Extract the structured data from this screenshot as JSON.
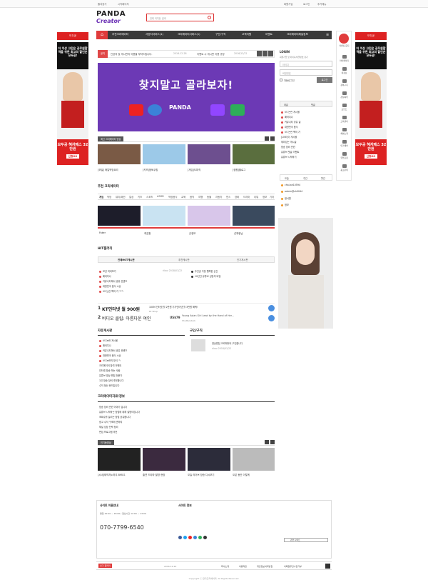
{
  "topbar": {
    "left1": "즐겨찾기",
    "left2": "시작페이지",
    "r1": "회원가입",
    "r2": "로그인",
    "r3": "추가메뉴"
  },
  "logo": {
    "line1": "PANDA",
    "line2": "Creator"
  },
  "search": {
    "placeholder": "언제 어디든 검색"
  },
  "nav": {
    "items": [
      "추천크리에이터",
      "사업자서비스(1)",
      "크리에이터서비스(1)",
      "구인/구직",
      "고객지원",
      "이벤트",
      "크리에이터채널정보"
    ]
  },
  "ad": {
    "head": "모두공",
    "black": "더 이상 고민은 공무원합격을 위한 최고의 할인은 모두공!",
    "foot": "모두공 혜자패스 32만원",
    "cta": "신청GO"
  },
  "notice": {
    "label": "공지",
    "text": "인공의 및 게시판의 이용을 부탁드립니다.",
    "date": "2016-12-28",
    "text2": "이벤트 시 게시판 이용 규정",
    "date2": "2016/12/22"
  },
  "banner": {
    "title": "찾지말고 골라보자!",
    "logo": "PANDA"
  },
  "sidebar": {
    "items": [
      "이벤트/공지",
      "마이페이지",
      "내정보",
      "장바구니",
      "관심목록",
      "포인트",
      "고객센터",
      "채널소개",
      "인기채널",
      "협업요청",
      "광고문의"
    ]
  },
  "recent": {
    "label": "최신 크리에이터 영상",
    "caps": [
      "[모빌] 매일먹방요리",
      "[키즈]점토쿠킹",
      "[게임]도파직",
      "[캠핑]블로그"
    ]
  },
  "rec": {
    "title": "추천 크리에이터",
    "tabs": [
      "게임",
      "먹방",
      "뷰티/패션",
      "일상",
      "키즈",
      "스포츠",
      "ASMR",
      "먹방음식",
      "교육",
      "음악",
      "여행",
      "동물",
      "자동차",
      "댄스",
      "영화",
      "드라마",
      "리뷰",
      "정보",
      "기타"
    ],
    "caps": [
      "Faker",
      "최호원",
      "곤정보",
      "선채현님"
    ]
  },
  "hit": {
    "title": "HIT갤러리",
    "tabs": [
      "전체HOT게시판",
      "추천게시판",
      "인기게시판"
    ],
    "left": [
      "모션 미리보기",
      "패러디나",
      "커뮤니티에서 공유 컨텐츠",
      "대한민국 음식 시상",
      "VS 논란 팩의 가 ㅋㅋ"
    ],
    "right": [
      "주인공 가장 행복한 순간",
      "10년간 유튜브 성장의 비밀"
    ],
    "meta": "rikov 2018/01/22"
  },
  "ads2": {
    "n1": "1",
    "l1": "KT인터넷 월 900원",
    "t1": "100M 인터넷 월 2만원 기가인터넷 월 3만원 혜택!",
    "s1": "KT Shop",
    "n2": "2",
    "l2": "비디오 클립: 아름다운 여인",
    "price": "US$79",
    "t2": "Young Asian Girl Lead by the Hand of Her...",
    "s2": "Shutterstock"
  },
  "free": {
    "title": "자유게시판",
    "rows": [
      "VS 논란 게시물",
      "패러디나",
      "커뮤니티에서 공유 컨텐츠",
      "대한민국 음식 시상",
      "VS 논란의 방식 ㅋ",
      "크리에이터 참여 이벤트",
      "인터넷 방송 하는 사람",
      "유튜브 영상 편집 전문가",
      "1인 방송 장비 추천합니다",
      "수익 정산 문의입니다"
    ]
  },
  "job": {
    "title": "구인/구직",
    "row": "영상편집 크리에이터 구인합니다",
    "meta": "rikov 2018/01/22"
  },
  "data": {
    "title": "크리에이터자료/정보",
    "rows": [
      "방송 장비 관련 이야기 입니다",
      "유튜브 시작하는 방법에 대해 설명드립니다",
      "조회수를 늘리는 방법 공유합니다",
      "광고 수익 구조에 관하여",
      "채널 성장 전략 정리",
      "편집 프로그램 추천"
    ]
  },
  "media": {
    "label": "인기동영상",
    "caps": [
      "[시네]제작자노하우 BMCS",
      "출연 드라마 촬영 현장",
      "오늘 라이브 방송 다시보기",
      "오분 동안 이렇게"
    ]
  },
  "login": {
    "title": "LOGIN",
    "link": "회원가입 및 아이디/비밀번호 찾기",
    "id": "아이디",
    "pw": "비밀번호",
    "btn": "로그인",
    "keep": "자동로그인",
    "find": "회원가입"
  },
  "newpost": {
    "tabs": [
      "새글",
      "댓글"
    ],
    "rows": [
      "VS 논란 게시물",
      "패러디나",
      "커뮤니티 공유 글",
      "대한민국 음식",
      "VS 논란 팩의 가",
      "[LIVE]이 게시물",
      "재미있는 게시글",
      "방송 장비 관련",
      "유튜브 댓글 이벤트",
      "유튜브 시작하기"
    ]
  },
  "rank": {
    "tabs": [
      "오늘",
      "주간",
      "월간"
    ],
    "rows": [
      "chai-ah10594",
      "admin@ch0044",
      "정서원",
      "정보"
    ]
  },
  "footer": {
    "h1": "사이트 이용안내",
    "h2": "사이트 정보",
    "tel": "070-7799-6540",
    "hours": "평일 10:00 ~ 18:00 / 점심시간 12:00 ~ 13:00",
    "sel": "관련 사이트"
  },
  "bottom": {
    "l": "인기 갤러리",
    "date": "2016-12-22",
    "links": [
      "회사소개",
      "이용약관",
      "개인정보처리방침",
      "이메일무단수집거부"
    ],
    "copy": "Copyright ⓒ 판다크리에이터. All Rights Reserved."
  }
}
